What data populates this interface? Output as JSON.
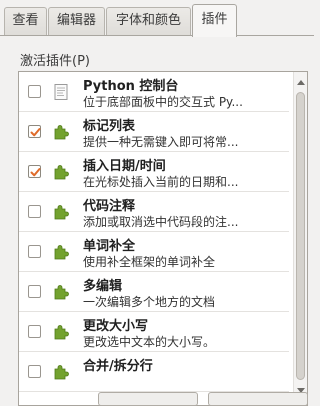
{
  "tabs": [
    {
      "label": "查看"
    },
    {
      "label": "编辑器"
    },
    {
      "label": "字体和颜色"
    },
    {
      "label": "插件"
    }
  ],
  "plugins_section": {
    "label": "激活插件(P)"
  },
  "plugins": [
    {
      "title": "Python 控制台",
      "description": "位于底部面板中的交互式 Py...",
      "checked": false,
      "icon": "python-console-icon"
    },
    {
      "title": "标记列表",
      "description": "提供一种无需键入即可将常...",
      "checked": true,
      "icon": "puzzle-piece-icon"
    },
    {
      "title": "插入日期/时间",
      "description": "在光标处插入当前的日期和...",
      "checked": true,
      "icon": "puzzle-piece-icon"
    },
    {
      "title": "代码注释",
      "description": "添加或取消选中代码段的注...",
      "checked": false,
      "icon": "puzzle-piece-icon"
    },
    {
      "title": "单词补全",
      "description": "使用补全框架的单词补全",
      "checked": false,
      "icon": "puzzle-piece-icon"
    },
    {
      "title": "多编辑",
      "description": "一次编辑多个地方的文档",
      "checked": false,
      "icon": "puzzle-piece-icon"
    },
    {
      "title": "更改大小写",
      "description": "更改选中文本的大小写。",
      "checked": false,
      "icon": "puzzle-piece-icon"
    },
    {
      "title": "合并/拆分行",
      "description": "",
      "checked": false,
      "icon": "puzzle-piece-icon"
    }
  ],
  "colors": {
    "check_mark": "#e06c2b",
    "plugin_green": "#73a22f"
  }
}
